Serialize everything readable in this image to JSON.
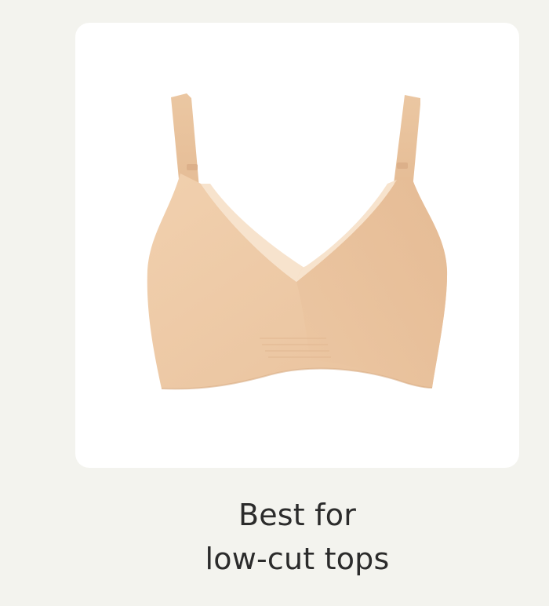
{
  "product_card": {
    "image_alt": "Nude seamless wireless bra",
    "caption_line1": "Best for",
    "caption_line2": "low-cut tops"
  },
  "colors": {
    "page_background": "#f3f3ee",
    "card_background": "#ffffff",
    "bra_fabric": "#efcba8",
    "bra_mesh": "#f4dcc3",
    "caption_text": "#2b2b2b"
  }
}
